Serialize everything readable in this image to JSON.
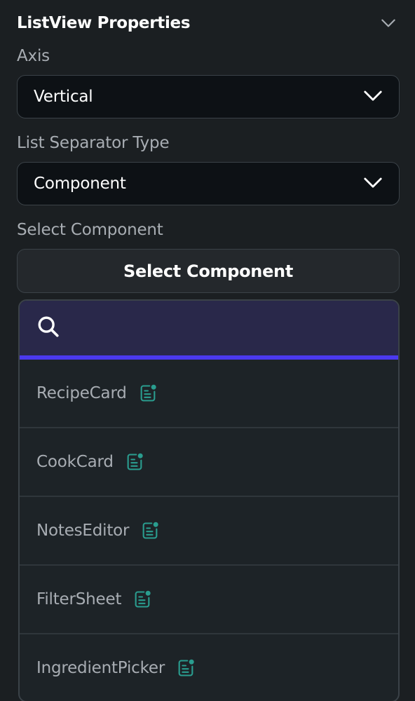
{
  "section": {
    "title": "ListView Properties",
    "collapse_icon": "chevron-down-icon"
  },
  "axis": {
    "label": "Axis",
    "value": "Vertical",
    "icon": "chevron-down-icon"
  },
  "separator_type": {
    "label": "List Separator Type",
    "value": "Component",
    "icon": "chevron-down-icon"
  },
  "select_component": {
    "label": "Select Component",
    "button_label": "Select Component"
  },
  "picker": {
    "search_icon": "search-icon",
    "search_value": "",
    "accent_color": "#4b39ef",
    "component_icon": "component-icon",
    "component_icon_color": "#2a9d8f",
    "items": [
      {
        "label": "RecipeCard"
      },
      {
        "label": "CookCard"
      },
      {
        "label": "NotesEditor"
      },
      {
        "label": "FilterSheet"
      },
      {
        "label": "IngredientPicker"
      }
    ]
  }
}
